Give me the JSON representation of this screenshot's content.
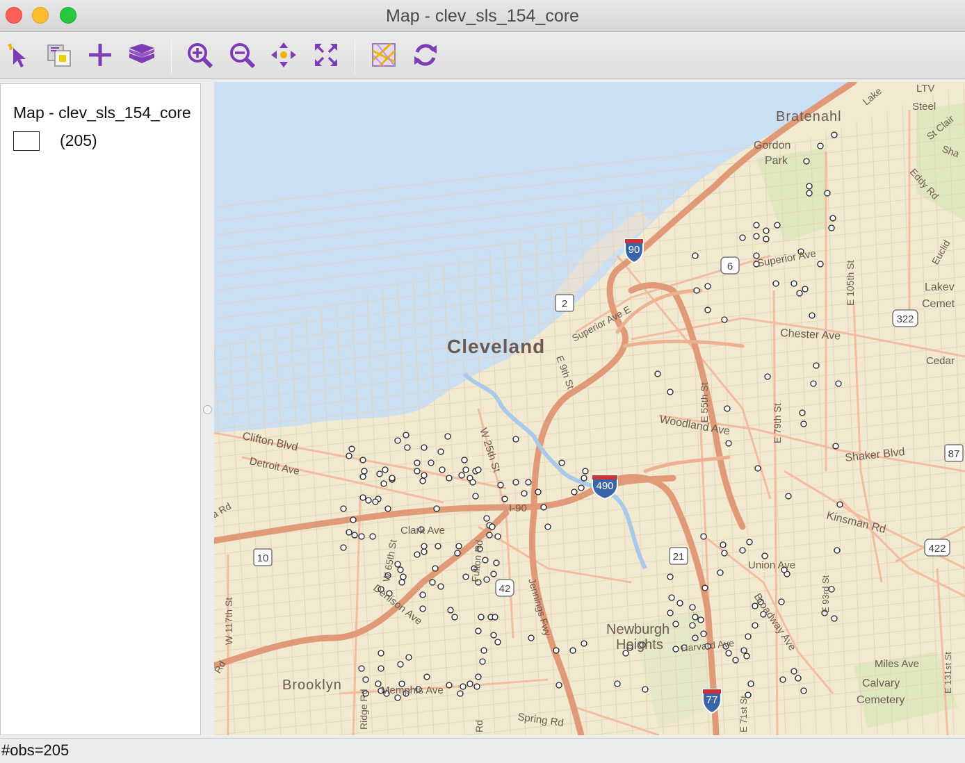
{
  "window": {
    "title": "Map - clev_sls_154_core"
  },
  "toolbar": {
    "buttons": [
      {
        "name": "select-tool-button",
        "icon": "pointer-arrow-icon"
      },
      {
        "name": "save-selection-button",
        "icon": "save-selection-icon"
      },
      {
        "name": "add-layer-button",
        "icon": "plus-icon"
      },
      {
        "name": "layers-button",
        "icon": "layers-icon"
      },
      {
        "name": "zoom-in-button",
        "icon": "zoom-in-icon"
      },
      {
        "name": "zoom-out-button",
        "icon": "zoom-out-icon"
      },
      {
        "name": "pan-button",
        "icon": "pan-arrows-icon"
      },
      {
        "name": "full-extent-button",
        "icon": "full-extent-icon"
      },
      {
        "name": "basemap-button",
        "icon": "basemap-icon"
      },
      {
        "name": "refresh-button",
        "icon": "refresh-icon"
      }
    ],
    "icon_color": "#7d3cb5"
  },
  "legend": {
    "layer_title": "Map - clev_sls_154_core",
    "category_count": "(205)"
  },
  "map": {
    "water_color": "#cadff2",
    "land_color": "#f1ead0",
    "highway_color": "#e09a78",
    "place_labels": {
      "cleveland": "Cleveland",
      "bratenahl": "Bratenahl",
      "brooklyn": "Brooklyn",
      "newburgh_1": "Newburgh",
      "newburgh_2": "Heights",
      "gordon_1": "Gordon",
      "gordon_2": "Park",
      "lakeview_1": "Lakev",
      "lakeview_2": "Cemet",
      "calvary_1": "Calvary",
      "calvary_2": "Cemetery",
      "ltv_1": "LTV",
      "ltv_2": "Steel"
    },
    "road_labels": {
      "clifton": "Clifton Blvd",
      "detroit": "Detroit Ave",
      "w25": "W 25th St",
      "superior_w": "Superior Ave E",
      "superior_e": "Superior Ave",
      "e9": "E 9th St",
      "chester": "Chester Ave",
      "e55": "E 55th St",
      "e79": "E 79th St",
      "e105": "E 105th St",
      "woodland": "Woodland Ave",
      "shaker": "Shaker Blvd",
      "kinsman": "Kinsman Rd",
      "union": "Union Ave",
      "e93": "E 93rd St",
      "broadway": "Broadway Ave",
      "miles": "Miles Ave",
      "clark": "Clark Ave",
      "w65": "W 65th St",
      "fulton": "Fulton Rd",
      "denison": "Denison Ave",
      "jennings": "Jennings Fwy",
      "i90": "I-90",
      "memphis": "Memphis Ave",
      "ridge": "Ridge Rd",
      "spring": "Spring Rd",
      "harvard": "Harvard Ave",
      "e71": "E 71st St",
      "e131": "E 131st St",
      "w117": "W 117th St",
      "cedar": "Cedar",
      "eddy": "Eddy Rd",
      "stclair": "St Clair",
      "lake": "Lake",
      "euclid": "Euclid",
      "sha": "Sha",
      "rd_left": "Rd",
      "rd_left2": "Rd",
      "rd_bottom": "Rd",
      "ard": "a Rd"
    },
    "shields": {
      "i90": "90",
      "i490": "490",
      "i77": "77",
      "us6": "6",
      "us322": "322",
      "us422": "422",
      "us42": "42",
      "sr2": "2",
      "sr10": "10",
      "sr21": "21",
      "sr87": "87"
    }
  },
  "status": {
    "text": "#obs=205"
  }
}
